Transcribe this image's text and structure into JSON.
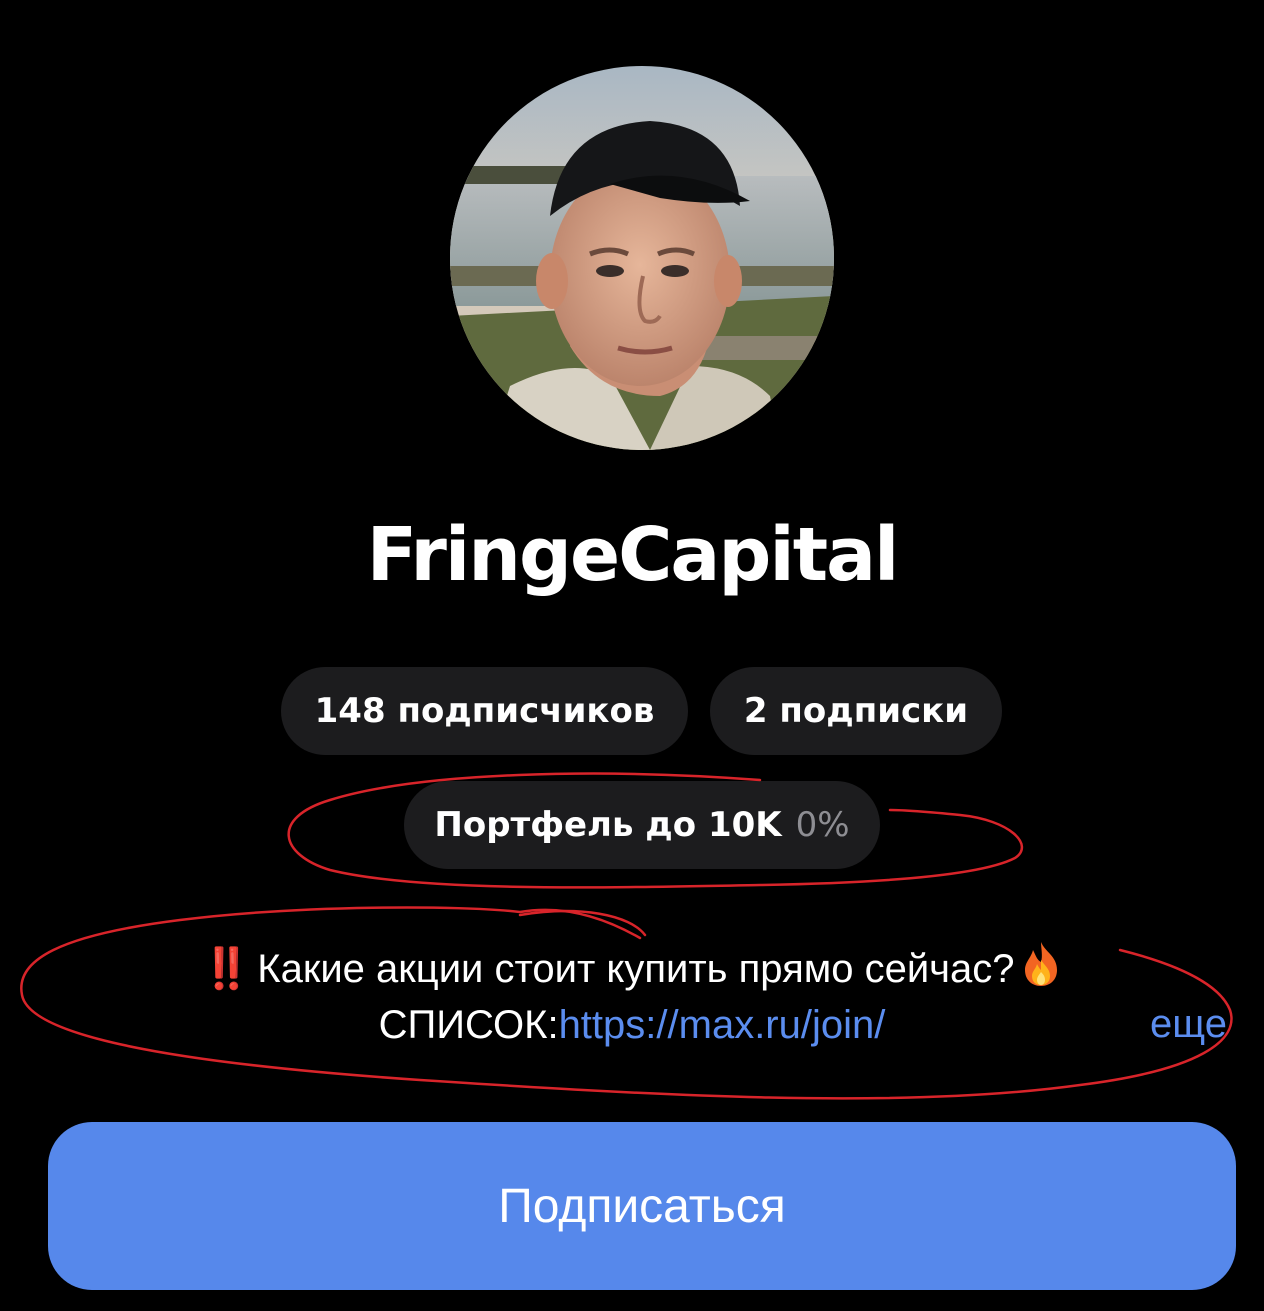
{
  "profile": {
    "avatar_icon": "avatar-photo",
    "name": "FringeCapital"
  },
  "stats": {
    "followers": "148 подписчиков",
    "following": "2 подписки"
  },
  "portfolio": {
    "label": "Портфель до 10K",
    "percent": "0%"
  },
  "bio": {
    "emoji": "‼️",
    "line1": "Какие акции стоит купить прямо сейчас?",
    "fire_icon": "fire-icon",
    "line2_prefix": "СПИСОК:",
    "link": "https://max.ru/join/",
    "more": "еще"
  },
  "subscribe_button": {
    "label": "Подписаться"
  },
  "colors": {
    "background": "#000000",
    "pill_bg": "#1c1c1e",
    "accent": "#5688eb",
    "link": "#5b8def",
    "muted": "#8e8e93",
    "annotation": "#d8242a"
  }
}
